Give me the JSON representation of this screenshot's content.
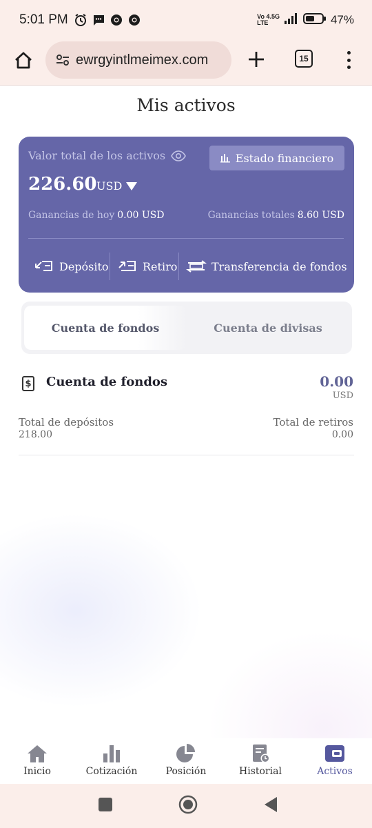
{
  "status_bar": {
    "time": "5:01 PM",
    "network_top": "Vo 4.5G",
    "network_bottom": "LTE",
    "battery": "47%"
  },
  "browser": {
    "url": "ewrgyintlmeimex.com",
    "tab_count": "15"
  },
  "page": {
    "title": "Mis activos"
  },
  "asset_card": {
    "total_label": "Valor total de los activos",
    "financial_statement_label": "Estado financiero",
    "total_value": "226.60",
    "currency": "USD",
    "gains_today_label": "Ganancias de hoy",
    "gains_today_value": "0.00 USD",
    "gains_total_label": "Ganancias totales",
    "gains_total_value": "8.60 USD",
    "actions": {
      "deposit": "Depósito",
      "withdraw": "Retiro",
      "transfer": "Transferencia de fondos"
    }
  },
  "account_tabs": {
    "active": "Cuenta de fondos",
    "other": "Cuenta de divisas"
  },
  "fund_account": {
    "title": "Cuenta de fondos",
    "value": "0.00",
    "currency": "USD",
    "deposits_label": "Total de depósitos",
    "deposits_value": "218.00",
    "withdrawals_label": "Total de retiros",
    "withdrawals_value": "0.00"
  },
  "bottom_nav": {
    "home": "Inicio",
    "quotes": "Cotización",
    "position": "Posición",
    "history": "Historial",
    "assets": "Activos"
  },
  "colors": {
    "accent": "#6566a8",
    "accent_light": "#8a8bc4",
    "active_nav": "#55589e",
    "browser_chrome": "#fbeeea"
  }
}
